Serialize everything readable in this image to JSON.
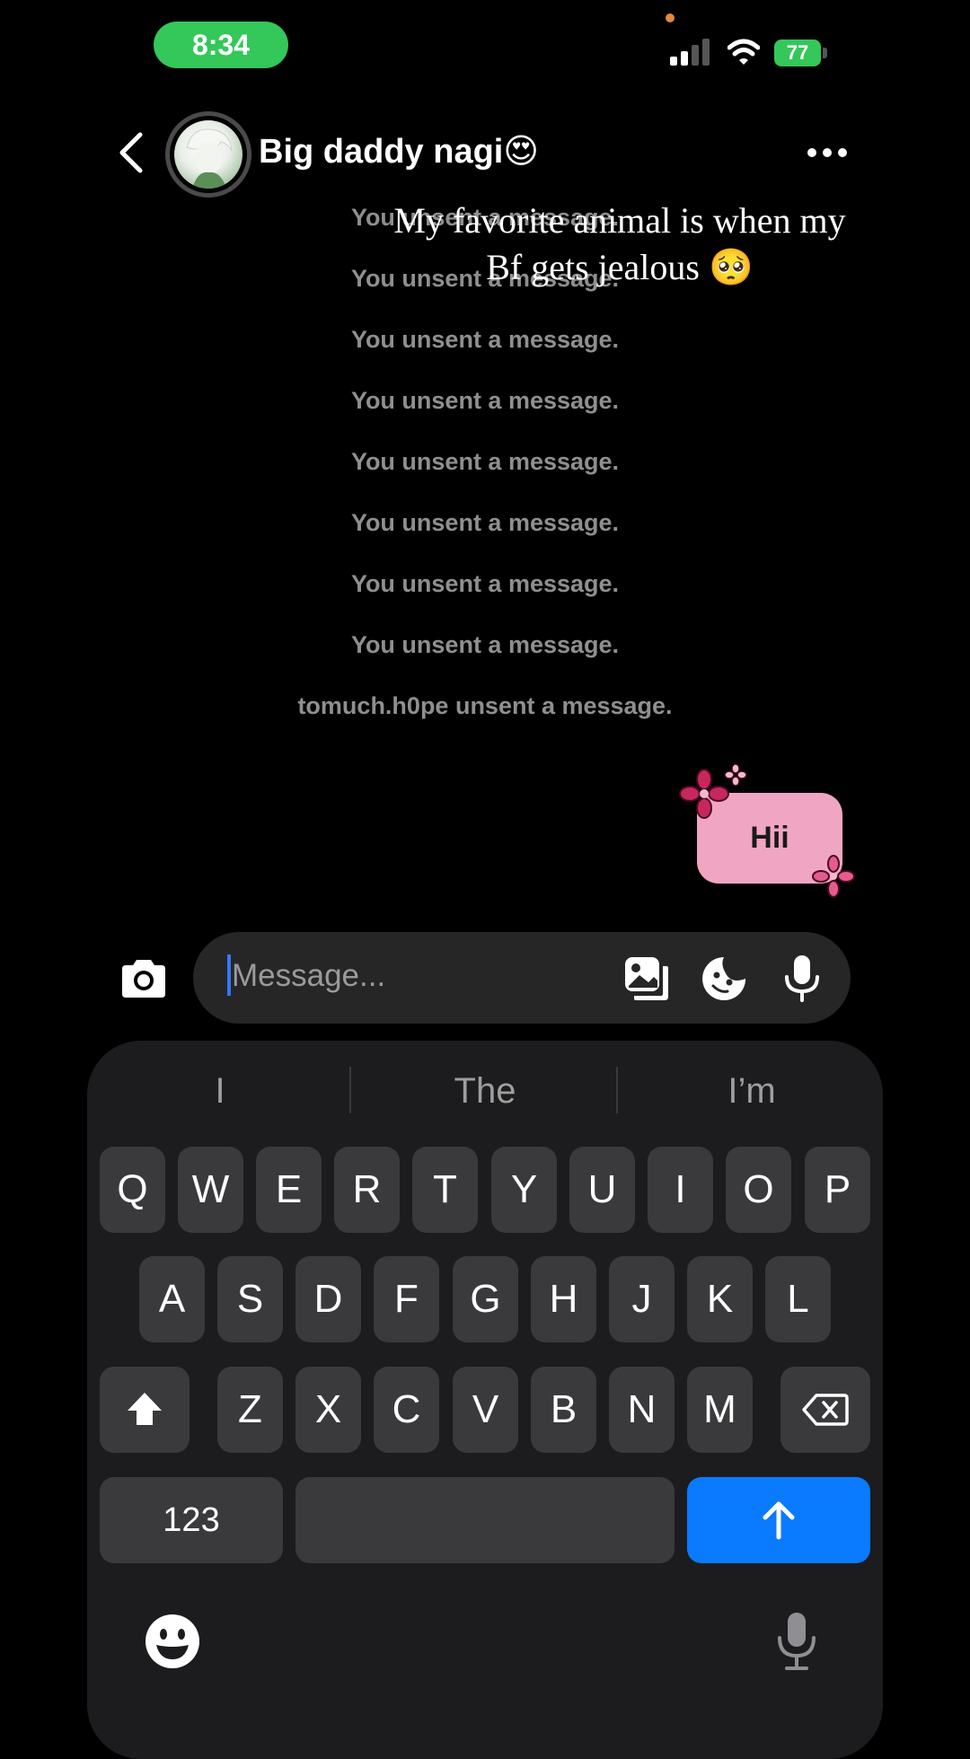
{
  "status_bar": {
    "time": "8:34",
    "battery": "77"
  },
  "header": {
    "contact_name": "Big daddy nagi😍"
  },
  "caption": {
    "line1": "My favorite animal is when my",
    "line2": "Bf gets jealous 🥺"
  },
  "messages": {
    "system": [
      "You unsent a message.",
      "You unsent a message.",
      "You unsent a message.",
      "You unsent a message.",
      "You unsent a message.",
      "You unsent a message.",
      "You unsent a message.",
      "You unsent a message.",
      "tomuch.h0pe unsent a message."
    ],
    "sent": "Hii"
  },
  "composer": {
    "placeholder": "Message..."
  },
  "keyboard": {
    "suggestions": [
      "I",
      "The",
      "I’m"
    ],
    "row1": [
      "Q",
      "W",
      "E",
      "R",
      "T",
      "Y",
      "U",
      "I",
      "O",
      "P"
    ],
    "row2": [
      "A",
      "S",
      "D",
      "F",
      "G",
      "H",
      "J",
      "K",
      "L"
    ],
    "row3": [
      "Z",
      "X",
      "C",
      "V",
      "B",
      "N",
      "M"
    ],
    "numbers_label": "123"
  },
  "colors": {
    "send_key": "#0a7aff",
    "bubble": "#f0a6c2",
    "accent_green": "#34c759"
  }
}
